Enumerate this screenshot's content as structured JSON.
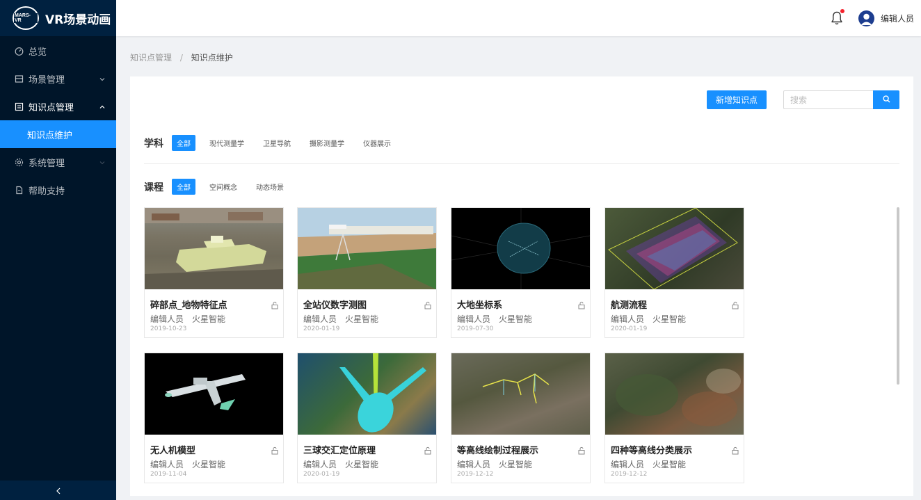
{
  "app": {
    "logo_text": "MARS-VR",
    "title": "VR场景动画"
  },
  "sidebar": {
    "items": [
      {
        "label": "总览",
        "icon": "dashboard-icon"
      },
      {
        "label": "场景管理",
        "icon": "scene-icon",
        "expandable": true
      },
      {
        "label": "知识点管理",
        "icon": "knowledge-icon",
        "expandable": true,
        "open": true,
        "children": [
          {
            "label": "知识点维护",
            "active": true
          }
        ]
      },
      {
        "label": "系统管理",
        "icon": "settings-icon",
        "expandable": true
      },
      {
        "label": "帮助支持",
        "icon": "help-doc-icon"
      }
    ]
  },
  "header": {
    "user_name": "编辑人员",
    "has_notification": true
  },
  "breadcrumb": {
    "parent": "知识点管理",
    "separator": "/",
    "current": "知识点维护"
  },
  "toolbar": {
    "add_label": "新增知识点",
    "search_placeholder": "搜索"
  },
  "filters": {
    "subject": {
      "label": "学科",
      "tags": [
        "全部",
        "现代测量学",
        "卫星导航",
        "摄影测量学",
        "仪器展示"
      ],
      "active_index": 0
    },
    "course": {
      "label": "课程",
      "tags": [
        "全部",
        "空间概念",
        "动态场景"
      ],
      "active_index": 0
    }
  },
  "cards": [
    {
      "title": "碎部点_地物特征点",
      "author": "编辑人员",
      "org": "火星智能",
      "date": "2019-10-23",
      "thumb": "building"
    },
    {
      "title": "全站仪数字测图",
      "author": "编辑人员",
      "org": "火星智能",
      "date": "2020-01-19",
      "thumb": "field"
    },
    {
      "title": "大地坐标系",
      "author": "编辑人员",
      "org": "火星智能",
      "date": "2019-07-30",
      "thumb": "globe"
    },
    {
      "title": "航测流程",
      "author": "编辑人员",
      "org": "火星智能",
      "date": "2020-01-19",
      "thumb": "aerial"
    },
    {
      "title": "无人机模型",
      "author": "编辑人员",
      "org": "火星智能",
      "date": "2019-11-04",
      "thumb": "drone"
    },
    {
      "title": "三球交汇定位原理",
      "author": "编辑人员",
      "org": "火星智能",
      "date": "2020-01-19",
      "thumb": "cones"
    },
    {
      "title": "等高线绘制过程展示",
      "author": "编辑人员",
      "org": "火星智能",
      "date": "2019-12-12",
      "thumb": "contour"
    },
    {
      "title": "四种等高线分类展示",
      "author": "编辑人员",
      "org": "火星智能",
      "date": "2019-12-12",
      "thumb": "terrain"
    }
  ],
  "colors": {
    "primary": "#1890ff",
    "sidebar_bg": "#001529",
    "notification": "#f5222d"
  }
}
